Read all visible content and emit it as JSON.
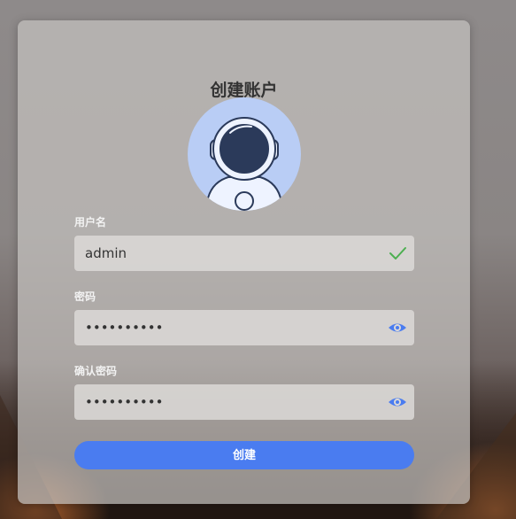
{
  "form": {
    "title": "创建账户",
    "username": {
      "label": "用户名",
      "value": "admin"
    },
    "password": {
      "label": "密码",
      "value": "••••••••••"
    },
    "confirm_password": {
      "label": "确认密码",
      "value": "••••••••••"
    },
    "submit_label": "创建"
  },
  "icons": {
    "avatar": "astronaut-avatar-icon",
    "username_status": "check-icon",
    "password_toggle": "eye-icon",
    "confirm_toggle": "eye-icon"
  },
  "colors": {
    "accent": "#4a7cf0",
    "valid": "#4caf50",
    "avatar_bg": "#b9cdf5"
  }
}
